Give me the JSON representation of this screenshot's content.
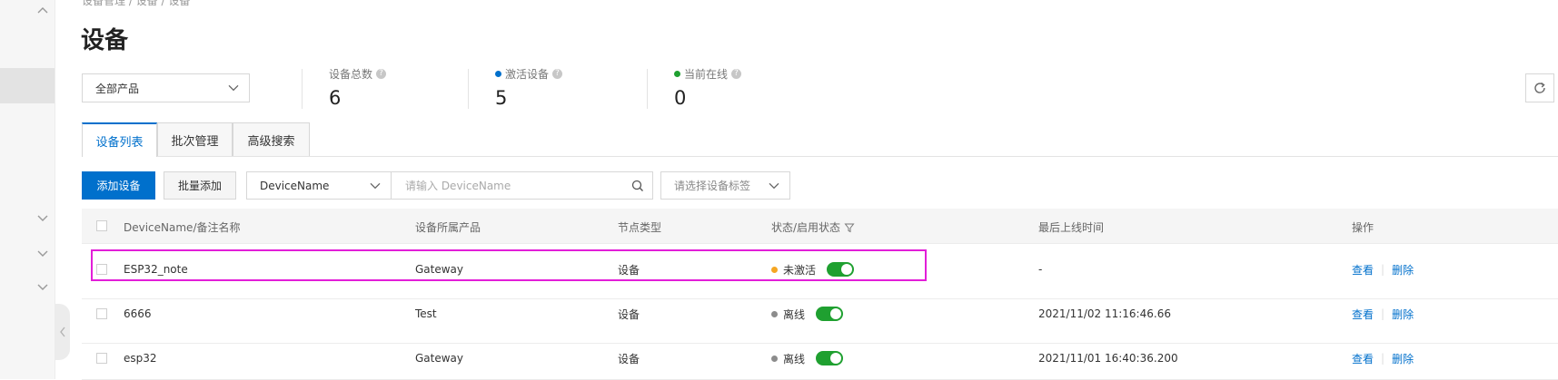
{
  "breadcrumb": "设备管理 / 设备 / 设备",
  "page_title": "设备",
  "product_filter": {
    "value": "全部产品"
  },
  "stats": [
    {
      "label": "设备总数",
      "value": "6",
      "dot_color": null
    },
    {
      "label": "激活设备",
      "value": "5",
      "dot_color": "#0070cc"
    },
    {
      "label": "当前在线",
      "value": "0",
      "dot_color": "#1fa030"
    }
  ],
  "tabs": [
    {
      "label": "设备列表",
      "active": true
    },
    {
      "label": "批次管理",
      "active": false
    },
    {
      "label": "高级搜索",
      "active": false
    }
  ],
  "toolbar": {
    "add_label": "添加设备",
    "batch_add_label": "批量添加",
    "field_select_value": "DeviceName",
    "search_placeholder": "请输入 DeviceName",
    "tag_select_placeholder": "请选择设备标签"
  },
  "table": {
    "columns": [
      "DeviceName/备注名称",
      "设备所属产品",
      "节点类型",
      "状态/启用状态",
      "最后上线时间",
      "操作"
    ],
    "rows": [
      {
        "name": "ESP32_note",
        "product": "Gateway",
        "node_type": "设备",
        "status": "未激活",
        "status_color": "#f5a623",
        "enabled": true,
        "last_online": "-",
        "view": "查看",
        "delete": "删除"
      },
      {
        "name": "6666",
        "product": "Test",
        "node_type": "设备",
        "status": "离线",
        "status_color": "#8c8c8c",
        "enabled": true,
        "last_online": "2021/11/02 11:16:46.66",
        "view": "查看",
        "delete": "删除"
      },
      {
        "name": "esp32",
        "product": "Gateway",
        "node_type": "设备",
        "status": "离线",
        "status_color": "#8c8c8c",
        "enabled": true,
        "last_online": "2021/11/01 16:40:36.200",
        "view": "查看",
        "delete": "删除"
      }
    ]
  },
  "colors": {
    "accent": "#0070cc",
    "online": "#1fa030",
    "inactive": "#f5a623",
    "highlight": "#e21ed8"
  }
}
